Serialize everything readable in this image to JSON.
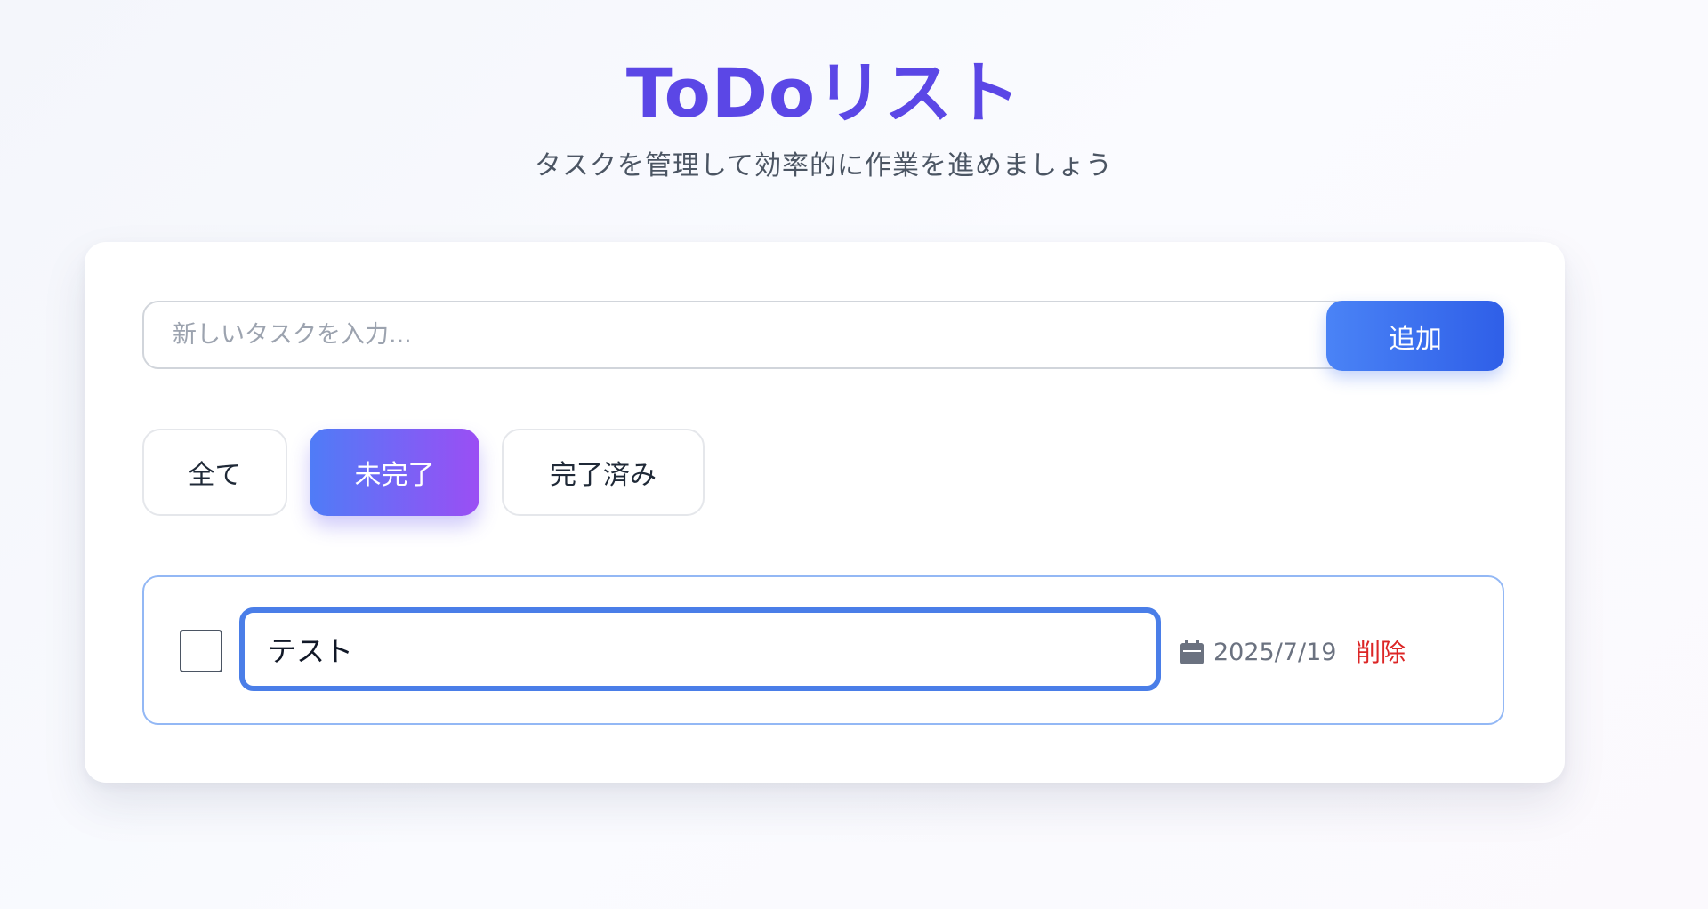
{
  "header": {
    "title": "ToDoリスト",
    "subtitle": "タスクを管理して効率的に作業を進めましょう"
  },
  "new_task": {
    "placeholder": "新しいタスクを入力...",
    "value": "",
    "add_label": "追加"
  },
  "filters": {
    "all_label": "全て",
    "active_label": "未完了",
    "done_label": "完了済み",
    "selected": "未完了"
  },
  "tasks": [
    {
      "text": "テスト",
      "date": "2025/7/19",
      "completed": false,
      "editing": true,
      "delete_label": "削除",
      "date_icon": "calendar-icon"
    }
  ],
  "colors": {
    "title": "#5b47e6",
    "primary": "#3b6ef0",
    "filter_gradient_start": "#4f7cf7",
    "filter_gradient_end": "#9b4ef4",
    "delete": "#dc2626",
    "edit_border": "#4a7ee8"
  }
}
